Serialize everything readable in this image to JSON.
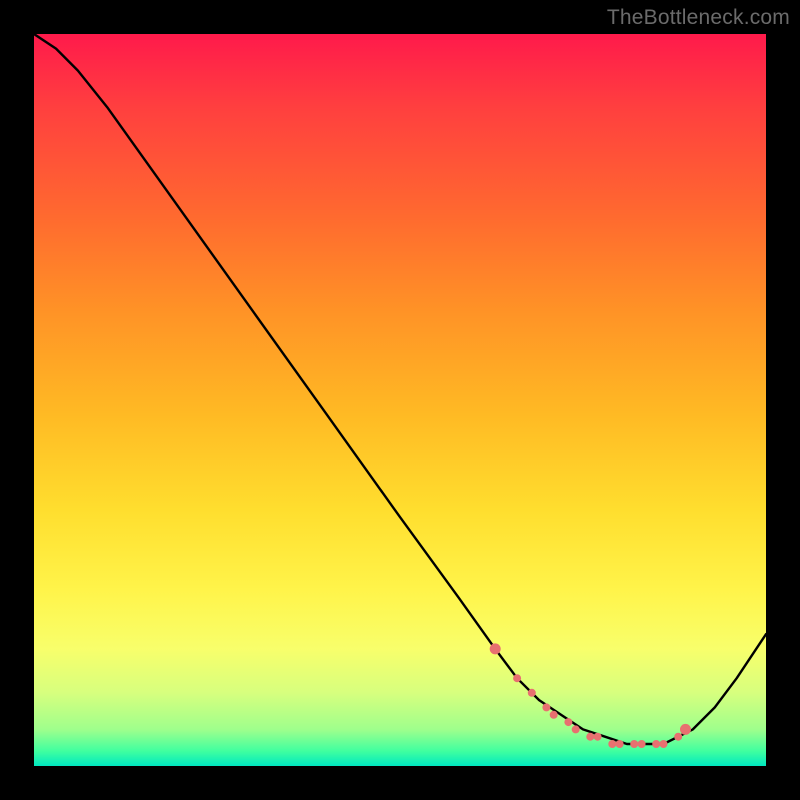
{
  "watermark": "TheBottleneck.com",
  "chart_data": {
    "type": "line",
    "title": "",
    "xlabel": "",
    "ylabel": "",
    "xlim": [
      0,
      100
    ],
    "ylim": [
      0,
      100
    ],
    "series": [
      {
        "name": "curve",
        "x": [
          0,
          3,
          6,
          10,
          20,
          30,
          40,
          50,
          58,
          63,
          66,
          69,
          72,
          75,
          78,
          81,
          84,
          86,
          88,
          90,
          93,
          96,
          100
        ],
        "y": [
          100,
          98,
          95,
          90,
          76,
          62,
          48,
          34,
          23,
          16,
          12,
          9,
          7,
          5,
          4,
          3,
          3,
          3,
          4,
          5,
          8,
          12,
          18
        ]
      }
    ],
    "markers": {
      "name": "dots",
      "color": "#e87070",
      "x": [
        63,
        66,
        68,
        70,
        71,
        73,
        74,
        76,
        77,
        79,
        80,
        82,
        83,
        85,
        86,
        88,
        89
      ],
      "y": [
        16,
        12,
        10,
        8,
        7,
        6,
        5,
        4,
        4,
        3,
        3,
        3,
        3,
        3,
        3,
        4,
        5
      ]
    }
  }
}
